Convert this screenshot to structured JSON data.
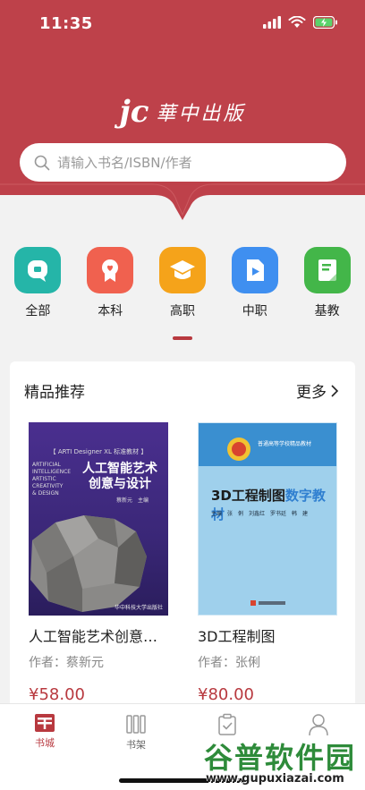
{
  "status": {
    "time": "11:35"
  },
  "brand": {
    "mark": "jc",
    "name": "華中出版"
  },
  "search": {
    "placeholder": "请输入书名/ISBN/作者"
  },
  "categories": [
    {
      "label": "全部",
      "color": "#25b5a8",
      "icon": "all-icon"
    },
    {
      "label": "本科",
      "color": "#f0614f",
      "icon": "ribbon-icon"
    },
    {
      "label": "高职",
      "color": "#f5a31a",
      "icon": "graduation-cap-icon"
    },
    {
      "label": "中职",
      "color": "#3f8ff0",
      "icon": "document-play-icon"
    },
    {
      "label": "基教",
      "color": "#43b649",
      "icon": "notebook-icon"
    }
  ],
  "recommend": {
    "title": "精品推荐",
    "more": "更多",
    "books": [
      {
        "title": "人工智能艺术创意…",
        "author_label": "作者：",
        "author": "蔡新元",
        "price": "¥58.00",
        "cover": {
          "series": "【 ARTI Designer XL 标准教材 】",
          "title_line1": "人工智能艺术",
          "title_line2": "创意与设计",
          "editor": "蔡新元　主编",
          "en_lines": [
            "ARTIFICIAL",
            "INTELLIGENCE",
            "ARTISTIC",
            "CREATIVITY",
            "& DESIGN"
          ],
          "publisher": "华中科技大学出版社"
        }
      },
      {
        "title": "3D工程制图",
        "author_label": "作者：",
        "author": "张俐",
        "price": "¥80.00",
        "cover": {
          "top_text": "普通高等学校精品教材",
          "title_a": "3D工程制图",
          "title_b": "数字教材",
          "editors": "主编　张　俐　刘鑫红　罗书廷　韩　建"
        }
      }
    ]
  },
  "tabs": [
    {
      "label": "书城",
      "active": true
    },
    {
      "label": "书架",
      "active": false
    },
    {
      "label": "",
      "active": false
    },
    {
      "label": "",
      "active": false
    }
  ],
  "watermark": {
    "text": "谷普软件园",
    "url": "www.gupuxiazai.com"
  },
  "colors": {
    "brand": "#b8393f",
    "header": "#c0424a"
  }
}
